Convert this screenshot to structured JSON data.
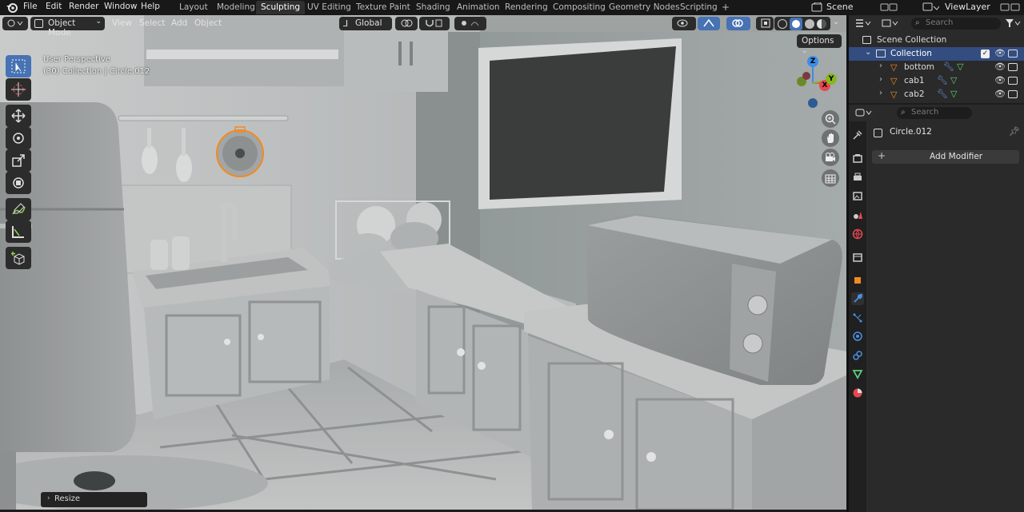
{
  "menubar": {
    "items": [
      "File",
      "Edit",
      "Render",
      "Window",
      "Help"
    ],
    "workspaces": [
      "Layout",
      "Modeling",
      "Sculpting",
      "UV Editing",
      "Texture Paint",
      "Shading",
      "Animation",
      "Rendering",
      "Compositing",
      "Geometry Nodes",
      "Scripting"
    ],
    "active_workspace": "Sculpting",
    "add_tab_label": "+",
    "scene_label": "Scene",
    "view_layer_label": "ViewLayer"
  },
  "viewport_header": {
    "mode_label": "Object Mode",
    "menus": [
      "View",
      "Select",
      "Add",
      "Object"
    ],
    "orientation_label": "Global",
    "options_label": "Options"
  },
  "viewport": {
    "perspective_text": "User Perspective",
    "object_info_text": "(30) Collection | Circle.012",
    "operator_panel_label": "Resize",
    "gizmo_axes": {
      "x": "X",
      "y": "Y",
      "z": "Z"
    }
  },
  "outliner": {
    "search_placeholder": "Search",
    "root_label": "Scene Collection",
    "collection_label": "Collection",
    "items": [
      {
        "label": "bottom"
      },
      {
        "label": "cab1"
      },
      {
        "label": "cab2"
      }
    ]
  },
  "properties": {
    "search_placeholder": "Search",
    "object_name": "Circle.012",
    "add_modifier_label": "Add Modifier"
  },
  "colors": {
    "accent": "#4772b3",
    "selection": "#f08a24",
    "axis_x": "#e8474f",
    "axis_y": "#86b620",
    "axis_z": "#3b8de8"
  }
}
